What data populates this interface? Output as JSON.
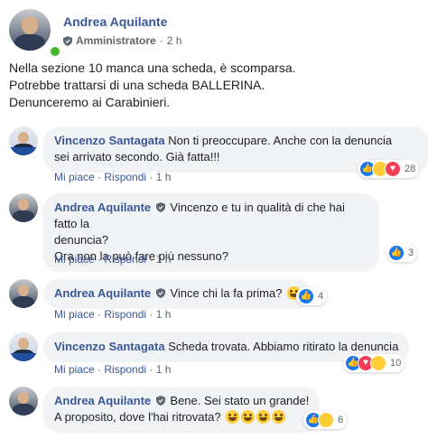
{
  "post": {
    "author": "Andrea Aquilante",
    "role": "Amministratore",
    "separator": "·",
    "time": "2 h",
    "lines": [
      "Nella sezione 10 manca una scheda, è scomparsa.",
      "Potrebbe trattarsi di una scheda BALLERINA.",
      "Denunceremo ai Carabinieri."
    ]
  },
  "comments": [
    {
      "author": "Vincenzo Santagata",
      "text_lines": [
        "Non ti preoccupare. Anche con la denuncia",
        "sei arrivato secondo. Già fatta!!!"
      ],
      "like": "Mi piace",
      "reply": "Rispondi",
      "time": "1 h",
      "reactions": [
        "like-icon",
        "haha-icon",
        "love-icon"
      ],
      "reaction_count": "28"
    },
    {
      "author": "Andrea Aquilante",
      "text_lines": [
        "Vincenzo e tu in qualità di che hai fatto la",
        "denuncia?",
        "Ora non la può fare più nessuno?"
      ],
      "like": "Mi piace",
      "reply": "Rispondi",
      "time": "1 h",
      "reactions": [
        "like-icon"
      ],
      "reaction_count": "3"
    },
    {
      "author": "Andrea Aquilante",
      "text_lines": [
        "Vince chi la fa prima?"
      ],
      "like": "Mi piace",
      "reply": "Rispondi",
      "time": "1 h",
      "reactions": [
        "like-icon"
      ],
      "reaction_count": "4"
    },
    {
      "author": "Vincenzo Santagata",
      "text_lines": [
        "Scheda trovata. Abbiamo ritirato la denuncia"
      ],
      "like": "Mi piace",
      "reply": "Rispondi",
      "time": "1 h",
      "reactions": [
        "like-icon",
        "love-icon",
        "haha-icon"
      ],
      "reaction_count": "10"
    },
    {
      "author": "Andrea Aquilante",
      "text_lines": [
        "Bene. Sei stato un grande!",
        "A proposito, dove l'hai ritrovata?"
      ],
      "like": "Mi piace",
      "reply": "Rispondi",
      "time": "1 h",
      "reactions": [
        "like-icon",
        "haha-icon"
      ],
      "reaction_count": "6"
    }
  ],
  "colors": {
    "link": "#385898",
    "meta": "#606770",
    "bubble": "#f2f3f5",
    "like": "#1877f2",
    "love": "#f33e58",
    "haha": "#ffcd38",
    "online": "#42b72a"
  }
}
